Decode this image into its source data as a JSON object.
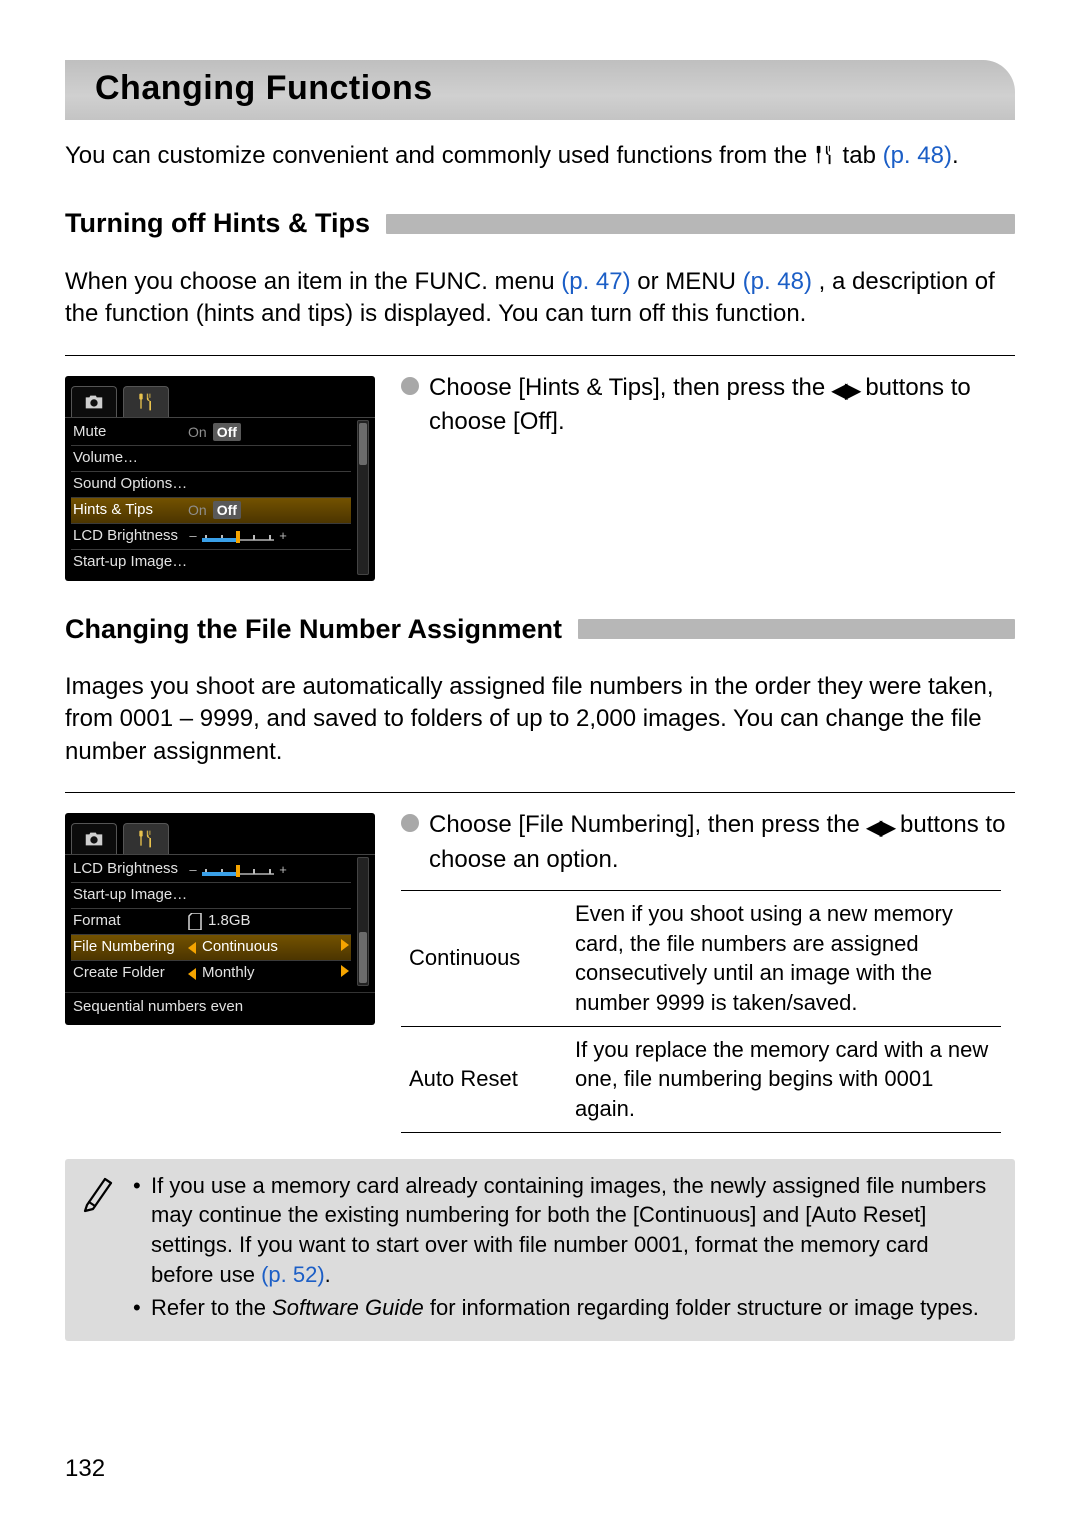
{
  "page_title": "Changing Functions",
  "intro": {
    "prefix": "You can customize convenient and commonly used functions from the ",
    "suffix": " tab ",
    "ref": "(p. 48)",
    "period": "."
  },
  "section1": {
    "heading": "Turning off Hints & Tips",
    "para_parts": {
      "a": "When you choose an item in the FUNC. menu ",
      "ref1": "(p. 47)",
      "b": " or MENU ",
      "ref2": "(p. 48)",
      "c": ", a description of the function (hints and tips) is displayed. You can turn off this function."
    },
    "step": {
      "a": "Choose [Hints & Tips], then press the ",
      "b": " buttons to choose [Off]."
    }
  },
  "lcd1": {
    "rows": [
      {
        "label": "Mute",
        "on": "On",
        "off": "Off",
        "off_hl": true
      },
      {
        "label": "Volume",
        "ellipsis": true
      },
      {
        "label": "Sound Options",
        "ellipsis": true
      },
      {
        "label": "Hints & Tips",
        "on": "On",
        "off": "Off",
        "off_hl": true,
        "selected": true
      },
      {
        "label": "LCD Brightness",
        "brightness": true
      },
      {
        "label": "Start-up Image",
        "ellipsis": true
      }
    ]
  },
  "section2": {
    "heading": "Changing the File Number Assignment",
    "para": "Images you shoot are automatically assigned file numbers in the order they were taken, from 0001 – 9999, and saved to folders of up to 2,000 images. You can change the file number assignment.",
    "step": {
      "a": "Choose [File Numbering], then press the ",
      "b": " buttons to choose an option."
    }
  },
  "lcd2": {
    "rows": [
      {
        "label": "LCD Brightness",
        "brightness": true
      },
      {
        "label": "Start-up Image",
        "ellipsis": true
      },
      {
        "label": "Format",
        "sd": true,
        "size": "1.8GB"
      },
      {
        "label": "File Numbering",
        "lr_value": "Continuous",
        "selected": true
      },
      {
        "label": "Create Folder",
        "lr_value": "Monthly"
      }
    ],
    "caption": "Sequential numbers even"
  },
  "options_table": [
    {
      "name": "Continuous",
      "desc": "Even if you shoot using a new memory card, the file numbers are assigned consecutively until an image with the number 9999 is taken/saved."
    },
    {
      "name": "Auto Reset",
      "desc": "If you replace the memory card with a new one, file numbering begins with 0001 again."
    }
  ],
  "note": {
    "item1": {
      "a": "If you use a memory card already containing images, the newly assigned file numbers may continue the existing numbering for both the [Continuous] and [Auto Reset] settings. If you want to start over with file number 0001, format the memory card before use ",
      "ref": "(p. 52)",
      "b": "."
    },
    "item2": {
      "a": "Refer to the ",
      "sw": "Software Guide",
      "b": " for information regarding folder structure or image types."
    }
  },
  "page_number": "132"
}
